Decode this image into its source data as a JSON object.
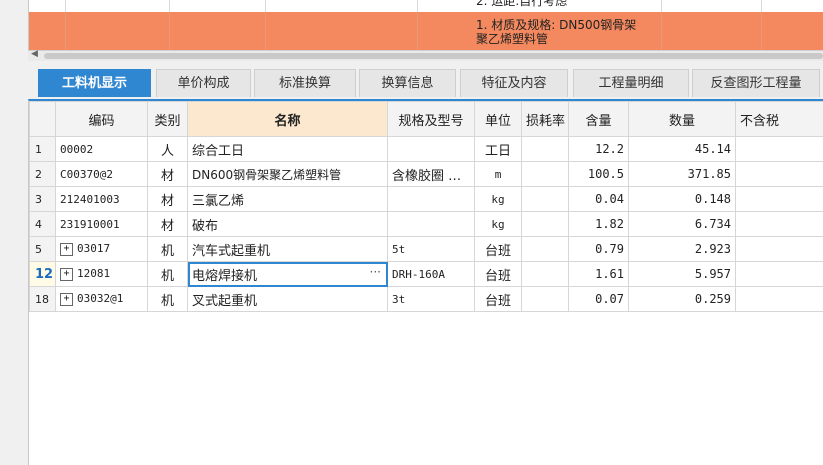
{
  "top": {
    "line1": "2. 运距:自行考虑",
    "line2": "1. 材质及规格: DN500钢骨架",
    "line3": "聚乙烯塑料管"
  },
  "tabs": [
    {
      "label": "工料机显示",
      "active": true
    },
    {
      "label": "单价构成"
    },
    {
      "label": "标准换算"
    },
    {
      "label": "换算信息"
    },
    {
      "label": "特征及内容"
    },
    {
      "label": "工程量明细"
    },
    {
      "label": "反查图形工程量"
    }
  ],
  "columns": [
    "编码",
    "类别",
    "名称",
    "规格及型号",
    "单位",
    "损耗率",
    "含量",
    "数量",
    "不含税"
  ],
  "rows": [
    {
      "no": "1",
      "code": "00002",
      "type": "人",
      "name": "综合工日",
      "spec": "",
      "unit": "工日",
      "loss": "",
      "qty": "12.2",
      "amount": "45.14",
      "ex": ""
    },
    {
      "no": "2",
      "code": "C00370@2",
      "type": "材",
      "name": "DN600钢骨架聚乙烯塑料管",
      "spec": "含橡胶圈 …",
      "unit": "m",
      "loss": "",
      "qty": "100.5",
      "amount": "371.85",
      "ex": ""
    },
    {
      "no": "3",
      "code": "212401003",
      "type": "材",
      "name": "三氯乙烯",
      "spec": "",
      "unit": "kg",
      "loss": "",
      "qty": "0.04",
      "amount": "0.148",
      "ex": ""
    },
    {
      "no": "4",
      "code": "231910001",
      "type": "材",
      "name": "破布",
      "spec": "",
      "unit": "kg",
      "loss": "",
      "qty": "1.82",
      "amount": "6.734",
      "ex": ""
    },
    {
      "no": "5",
      "code": "03017",
      "type": "机",
      "name": "汽车式起重机",
      "spec": "5t",
      "unit": "台班",
      "loss": "",
      "qty": "0.79",
      "amount": "2.923",
      "ex": "",
      "expand": true
    },
    {
      "no": "12",
      "code": "12081",
      "type": "机",
      "name": "电熔焊接机",
      "spec": "DRH-160A",
      "unit": "台班",
      "loss": "",
      "qty": "1.61",
      "amount": "5.957",
      "ex": "",
      "expand": true,
      "selected": true
    },
    {
      "no": "18",
      "code": "03032@1",
      "type": "机",
      "name": "叉式起重机",
      "spec": "3t",
      "unit": "台班",
      "loss": "",
      "qty": "0.07",
      "amount": "0.259",
      "ex": "",
      "expand": true
    }
  ],
  "icons": {
    "expand": "plus-box-icon",
    "more": "ellipsis-icon"
  },
  "colors": {
    "accent": "#2f86d1",
    "highlight_row": "#f4895f",
    "name_header": "#fbe8cf"
  }
}
